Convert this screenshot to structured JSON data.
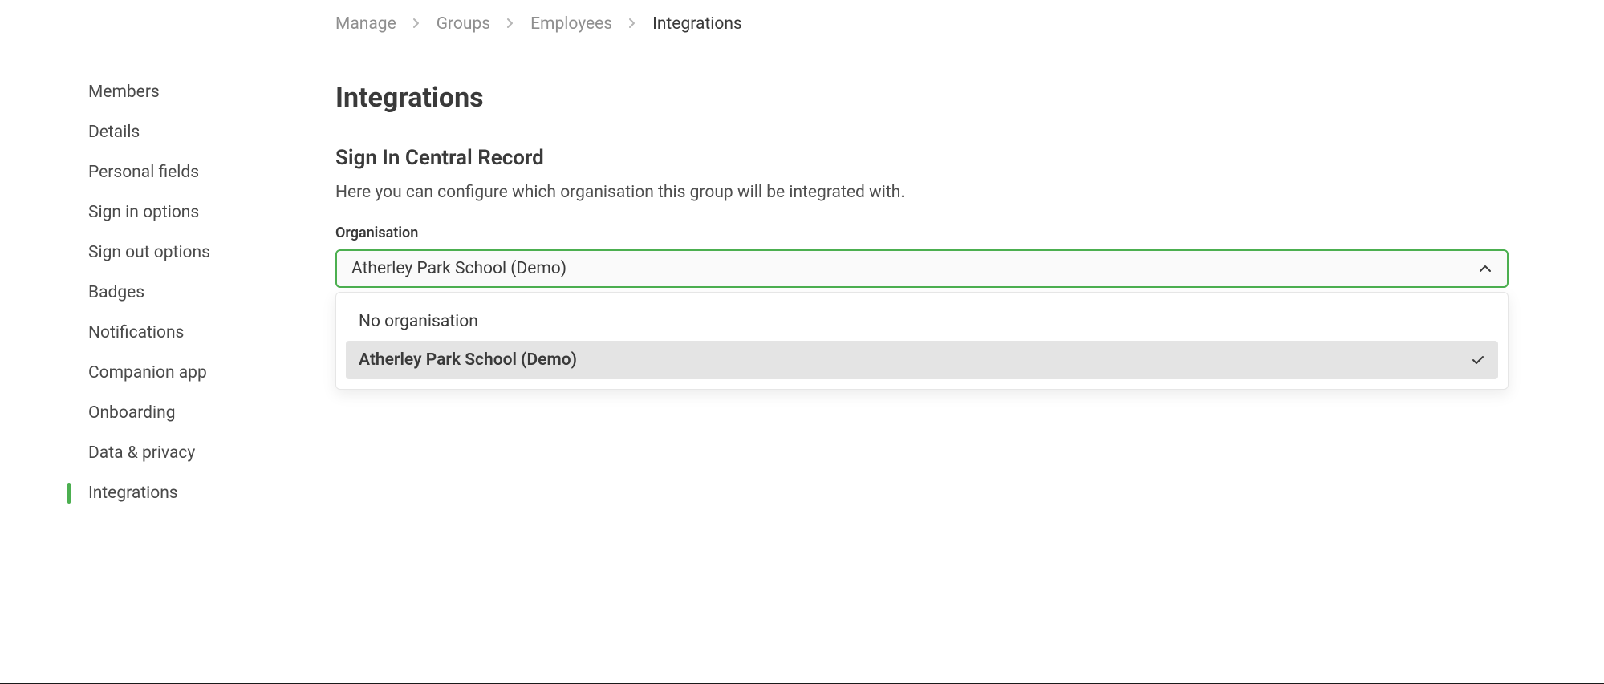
{
  "breadcrumb": {
    "items": [
      {
        "label": "Manage"
      },
      {
        "label": "Groups"
      },
      {
        "label": "Employees"
      },
      {
        "label": "Integrations"
      }
    ]
  },
  "sidebar": {
    "items": [
      {
        "label": "Members"
      },
      {
        "label": "Details"
      },
      {
        "label": "Personal fields"
      },
      {
        "label": "Sign in options"
      },
      {
        "label": "Sign out options"
      },
      {
        "label": "Badges"
      },
      {
        "label": "Notifications"
      },
      {
        "label": "Companion app"
      },
      {
        "label": "Onboarding"
      },
      {
        "label": "Data & privacy"
      },
      {
        "label": "Integrations"
      }
    ],
    "activeIndex": 10
  },
  "main": {
    "title": "Integrations",
    "section": {
      "title": "Sign In Central Record",
      "description": "Here you can configure which organisation this group will be integrated with.",
      "field_label": "Organisation",
      "selected": "Atherley Park School (Demo)",
      "options": [
        {
          "label": "No organisation",
          "selected": false
        },
        {
          "label": "Atherley Park School (Demo)",
          "selected": true
        }
      ]
    }
  }
}
